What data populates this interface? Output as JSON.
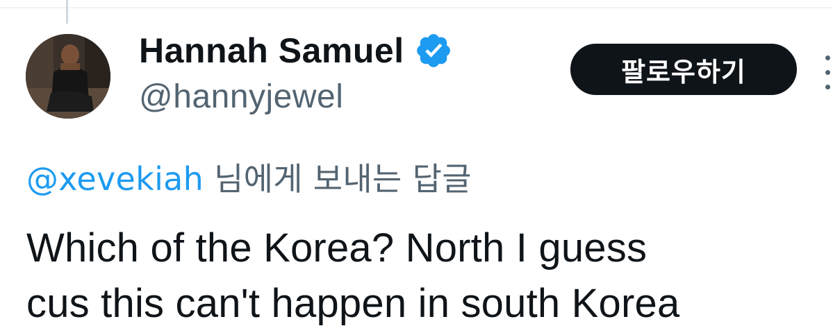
{
  "tweet": {
    "author": {
      "display_name": "Hannah Samuel",
      "handle": "@hannyjewel",
      "verified": true,
      "avatar": "profile-photo"
    },
    "follow_button_label": "팔로우하기",
    "more_icon": "more-horizontal-icon",
    "reply_to": {
      "mention": "@xevekiah",
      "suffix": " 님에게 보내는 답글"
    },
    "text_lines": [
      "Which of the Korea? North I guess",
      "cus this can't happen in south Korea"
    ]
  },
  "colors": {
    "accent": "#1d9bf0",
    "secondary_text": "#536471",
    "primary_text": "#0f1419",
    "button_bg": "#0f1419",
    "button_text": "#ffffff"
  }
}
